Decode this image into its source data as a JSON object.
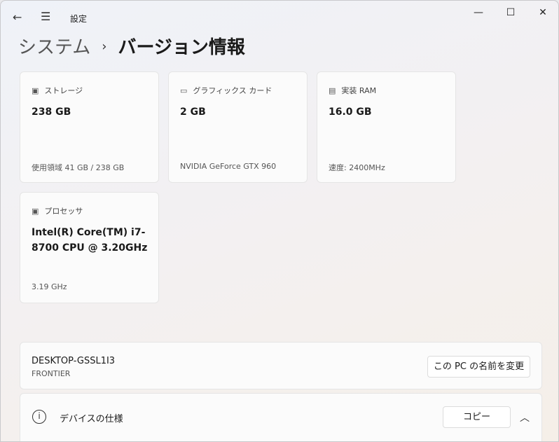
{
  "window": {
    "title": "設定",
    "minimize": "—",
    "maximize": "☐",
    "close": "✕"
  },
  "breadcrumb": {
    "parent": "システム",
    "separator": "›",
    "current": "バージョン情報"
  },
  "cards": [
    {
      "label": "ストレージ",
      "value": "238 GB",
      "sub": "使用領域 41 GB / 238 GB"
    },
    {
      "label": "グラフィックス カード",
      "value": "2 GB",
      "sub": "NVIDIA GeForce GTX 960"
    },
    {
      "label": "実装 RAM",
      "value": "16.0 GB",
      "sub": "速度: 2400MHz"
    },
    {
      "label": "プロセッサ",
      "value": "Intel(R) Core(TM) i7-8700 CPU @ 3.20GHz",
      "sub": "3.19 GHz"
    }
  ],
  "device": {
    "name": "DESKTOP-GSSL1I3",
    "model": "FRONTIER",
    "rename_button": "この PC の名前を変更"
  },
  "specs": {
    "title": "デバイスの仕様",
    "copy_button": "コピー"
  }
}
